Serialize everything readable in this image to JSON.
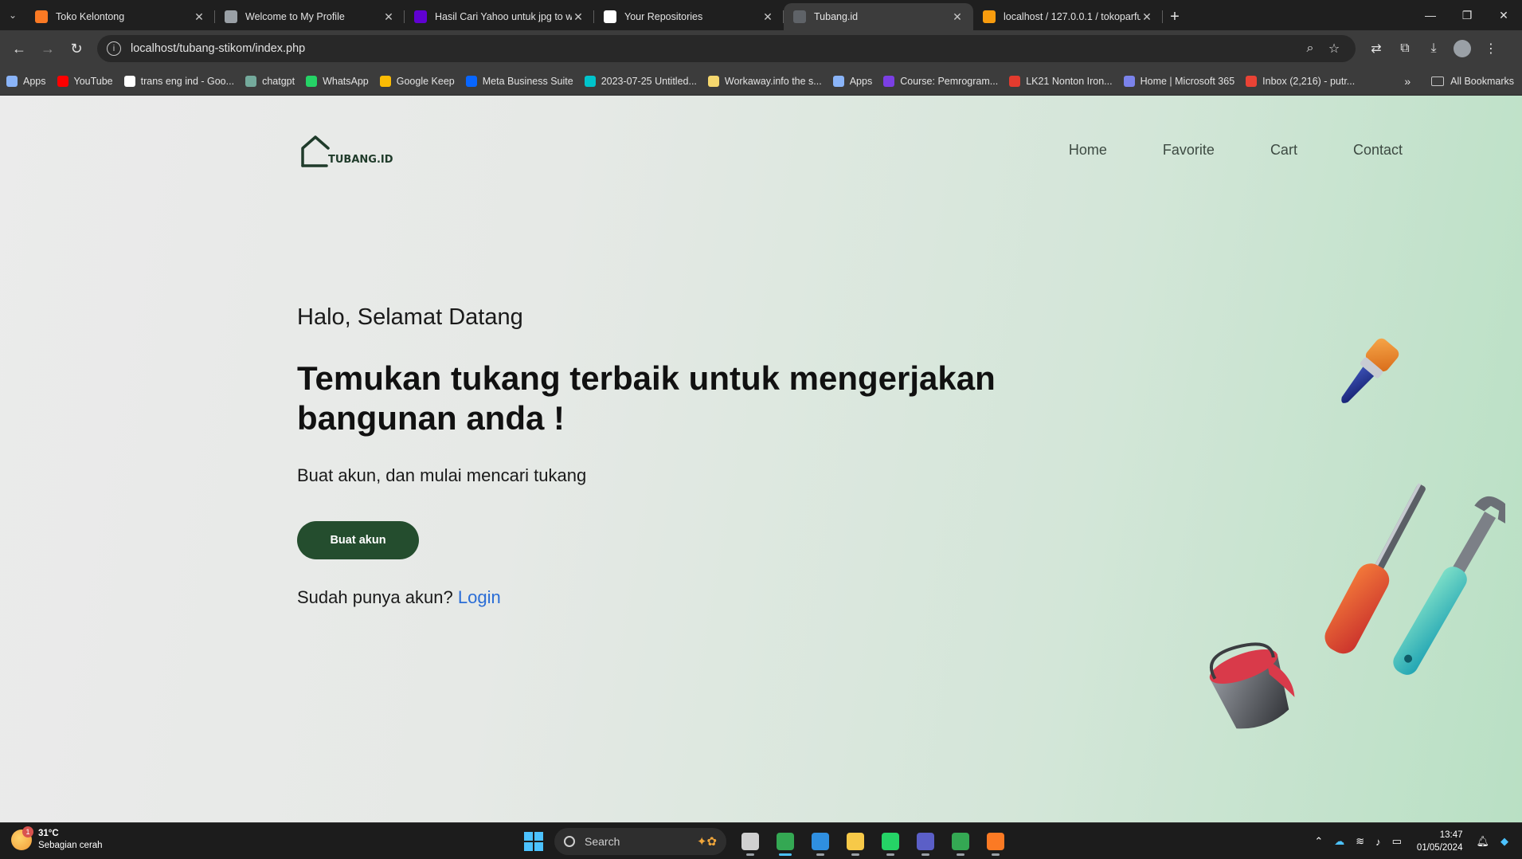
{
  "browser": {
    "tabs": [
      {
        "title": "Toko Kelontong",
        "icon": "xampp-icon",
        "color": "#fb7a24",
        "active": false
      },
      {
        "title": "Welcome to My Profile",
        "icon": "globe-icon",
        "color": "#9aa0a6",
        "active": false
      },
      {
        "title": "Hasil Cari Yahoo untuk jpg to w",
        "icon": "yahoo-icon",
        "color": "#6001d2",
        "active": false
      },
      {
        "title": "Your Repositories",
        "icon": "github-icon",
        "color": "#ffffff",
        "active": false
      },
      {
        "title": "Tubang.id",
        "icon": "page-icon",
        "color": "#5f6368",
        "active": true
      },
      {
        "title": "localhost / 127.0.0.1 / tokoparfu",
        "icon": "phpmyadmin-icon",
        "color": "#f89c0e",
        "active": false
      }
    ],
    "new_tab_glyph": "+",
    "url": "localhost/tubang-stikom/index.php",
    "bookmarks": [
      {
        "label": "Apps",
        "icon": "apps-icon",
        "color": "#8ab4f8"
      },
      {
        "label": "YouTube",
        "icon": "youtube-icon",
        "color": "#ff0000"
      },
      {
        "label": "trans eng ind - Goo...",
        "icon": "google-icon",
        "color": "#ffffff"
      },
      {
        "label": "chatgpt",
        "icon": "chatgpt-icon",
        "color": "#74aa9c"
      },
      {
        "label": "WhatsApp",
        "icon": "whatsapp-icon",
        "color": "#25d366"
      },
      {
        "label": "Google Keep",
        "icon": "keep-icon",
        "color": "#fbbc04"
      },
      {
        "label": "Meta Business Suite",
        "icon": "meta-icon",
        "color": "#0866ff"
      },
      {
        "label": "2023-07-25 Untitled...",
        "icon": "canva-icon",
        "color": "#00c4cc"
      },
      {
        "label": "Workaway.info the s...",
        "icon": "workaway-icon",
        "color": "#f5d76e"
      },
      {
        "label": "Apps",
        "icon": "apps-icon",
        "color": "#8ab4f8"
      },
      {
        "label": "Course: Pemrogram...",
        "icon": "course-icon",
        "color": "#7b3fe4"
      },
      {
        "label": "LK21 Nonton Iron...",
        "icon": "lk21-icon",
        "color": "#e33b2e"
      },
      {
        "label": "Home | Microsoft 365",
        "icon": "m365-icon",
        "color": "#7b83eb"
      },
      {
        "label": "Inbox (2,216) - putr...",
        "icon": "gmail-icon",
        "color": "#ea4335"
      }
    ],
    "all_bookmarks_label": "All Bookmarks"
  },
  "site": {
    "logo_text": "TUBANG.ID",
    "nav": [
      "Home",
      "Favorite",
      "Cart",
      "Contact"
    ],
    "greeting": "Halo, Selamat Datang",
    "headline": "Temukan tukang terbaik untuk mengerjakan bangunan anda !",
    "subtext": "Buat akun, dan mulai mencari tukang",
    "cta_label": "Buat akun",
    "login_prompt": "Sudah punya akun?",
    "login_link": "Login",
    "colors": {
      "primary": "#244d2e",
      "link": "#2a6dd6",
      "gradient_end": "#b9e0c4"
    }
  },
  "taskbar": {
    "weather_temp": "31°C",
    "weather_desc": "Sebagian cerah",
    "weather_badge": "1",
    "search_placeholder": "Search",
    "time": "13:47",
    "date": "01/05/2024",
    "apps": [
      {
        "name": "task-view-icon",
        "color": "#d0d0d0",
        "active": false
      },
      {
        "name": "chrome-icon",
        "color": "#34a853",
        "active": true
      },
      {
        "name": "vscode-icon",
        "color": "#2f8fe0",
        "active": false
      },
      {
        "name": "file-explorer-icon",
        "color": "#f7c948",
        "active": false
      },
      {
        "name": "whatsapp-icon",
        "color": "#25d366",
        "active": false
      },
      {
        "name": "teams-icon",
        "color": "#5b5fc7",
        "active": false
      },
      {
        "name": "chrome-profile-icon",
        "color": "#34a853",
        "active": false
      },
      {
        "name": "xampp-icon",
        "color": "#fb7a24",
        "active": false
      }
    ]
  }
}
